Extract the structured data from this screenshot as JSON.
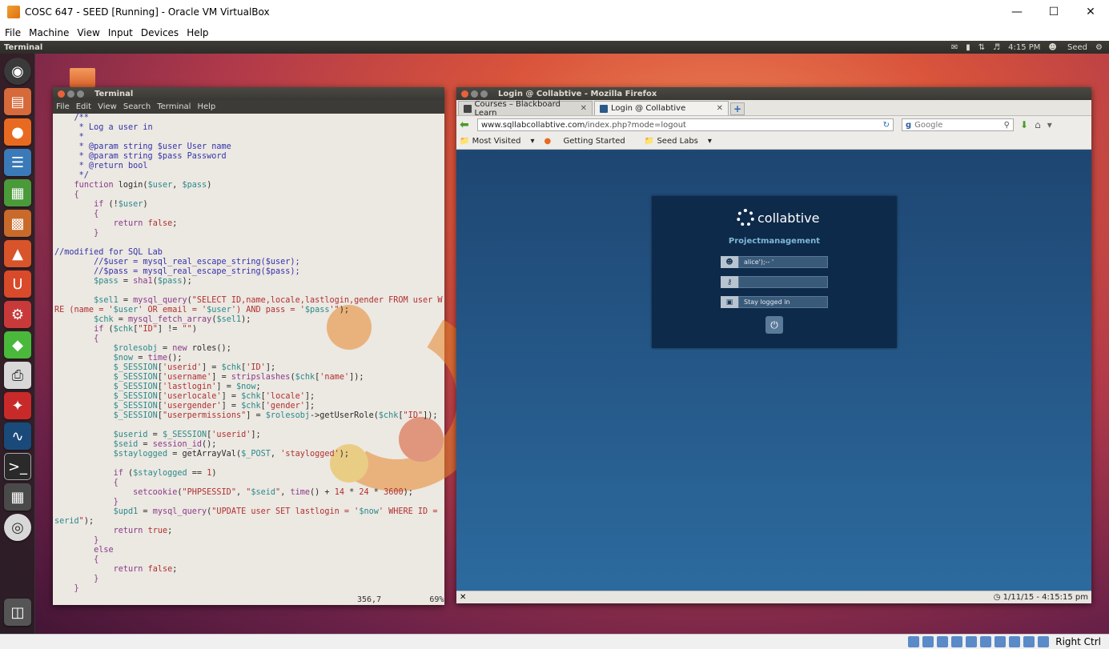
{
  "vbox": {
    "title": "COSC 647 - SEED [Running] - Oracle VM VirtualBox",
    "menu": [
      "File",
      "Machine",
      "View",
      "Input",
      "Devices",
      "Help"
    ],
    "host_key": "Right Ctrl"
  },
  "panel": {
    "app_label": "Terminal",
    "time": "4:15 PM",
    "user": "Seed"
  },
  "terminal": {
    "title": "Terminal",
    "menu": [
      "File",
      "Edit",
      "View",
      "Search",
      "Terminal",
      "Help"
    ],
    "cursor_pos": "356,7",
    "percent": "69%"
  },
  "firefox": {
    "title": "Login @ Collabtive - Mozilla Firefox",
    "tabs": [
      {
        "label": "Courses – Blackboard Learn"
      },
      {
        "label": "Login @ Collabtive"
      }
    ],
    "url_host": "www.sqllabcollabtive.com",
    "url_path": "/index.php?mode=logout",
    "search_placeholder": "Google",
    "bookmarks": [
      "Most Visited",
      "Getting Started",
      "Seed Labs"
    ],
    "status_date": "1/11/15 - 4:15:15 pm"
  },
  "login": {
    "brand": "collabtive",
    "subtitle": "Projectmanagement",
    "username_value": "alice');-- '",
    "password_value": "",
    "stay_label": "Stay logged in"
  }
}
